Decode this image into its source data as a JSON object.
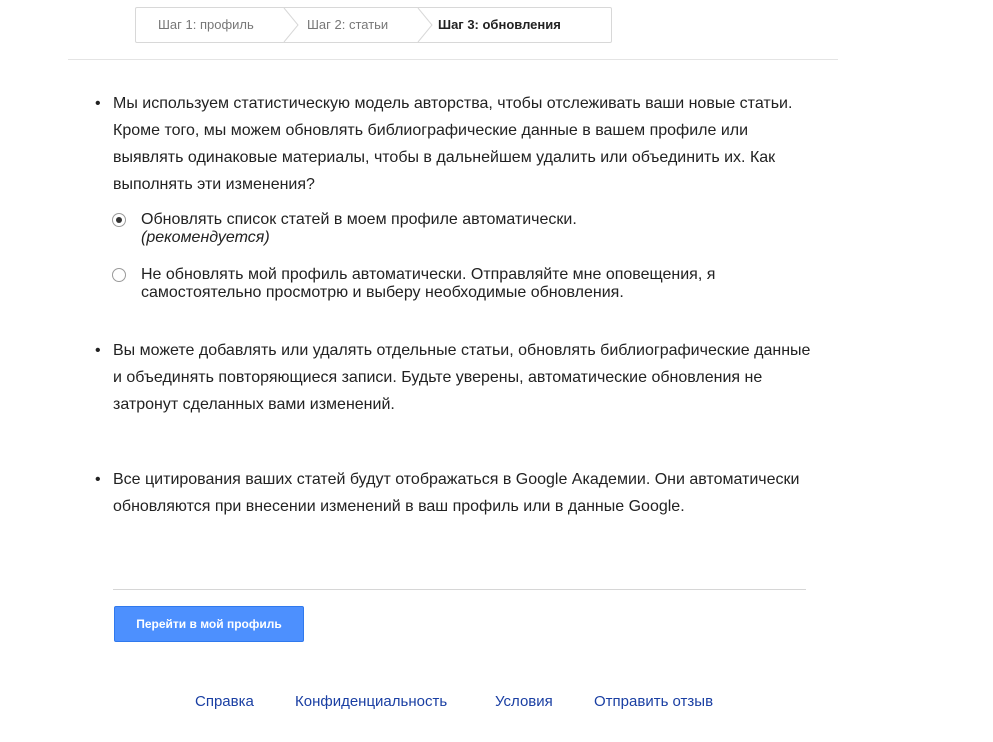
{
  "steps": {
    "step1": "Шаг 1: профиль",
    "step2": "Шаг 2: статьи",
    "step3": "Шаг 3: обновления"
  },
  "bullet_char": "•",
  "paragraphs": {
    "p1": "Мы используем статистическую модель авторства, чтобы отслеживать ваши новые статьи. Кроме того, мы можем обновлять библиографические данные в вашем профиле или выявлять одинаковые материалы, чтобы в дальнейшем удалить или объединить их. Как выполнять эти изменения?",
    "p2": "Вы можете добавлять или удалять отдельные статьи, обновлять библиографические данные и объединять повторяющиеся записи. Будьте уверены, автоматические обновления не затронут сделанных вами изменений.",
    "p3": "Все цитирования ваших статей будут отображаться в Google Академии. Они автоматически обновляются при внесении изменений в ваш профиль или в данные Google."
  },
  "options": {
    "auto": {
      "label": "Обновлять список статей в моем профиле автоматически.",
      "note": "(рекомендуется)",
      "selected": true
    },
    "manual": {
      "label": "Не обновлять мой профиль автоматически. Отправляйте мне оповещения, я самостоятельно просмотрю и выберу необходимые обновления.",
      "selected": false
    }
  },
  "button": {
    "label": "Перейти в мой профиль"
  },
  "footer": {
    "help": "Справка",
    "privacy": "Конфиденциальность",
    "terms": "Условия",
    "feedback": "Отправить отзыв"
  },
  "colors": {
    "primary_button": "#4d90fe",
    "link": "#1a3fa3"
  }
}
